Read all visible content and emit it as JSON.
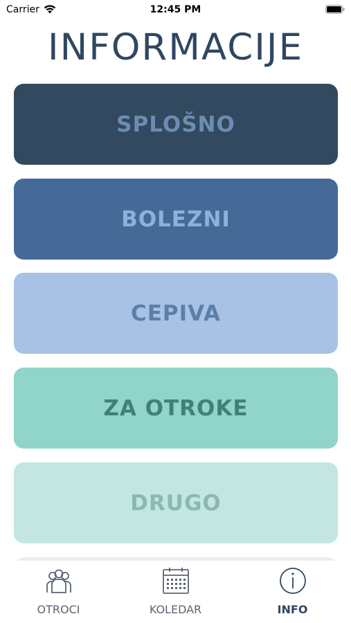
{
  "status_bar": {
    "carrier": "Carrier",
    "time": "12:45 PM",
    "icons": [
      "wifi-icon",
      "battery-icon"
    ]
  },
  "page": {
    "title": "INFORMACIJE"
  },
  "menu": {
    "items": [
      {
        "label": "SPLOŠNO",
        "color": "#33495f",
        "text_color": "#6b8db3"
      },
      {
        "label": "BOLEZNI",
        "color": "#466a98",
        "text_color": "#8fb0dc"
      },
      {
        "label": "CEPIVA",
        "color": "#a7c2e4",
        "text_color": "#5c7fa8"
      },
      {
        "label": "ZA OTROKE",
        "color": "#91d4ca",
        "text_color": "#3f8178"
      },
      {
        "label": "DRUGO",
        "color": "#c4e6e2",
        "text_color": "#8cb8b3"
      }
    ]
  },
  "tab_bar": {
    "tabs": [
      {
        "label": "OTROCI",
        "icon": "people-icon",
        "active": false
      },
      {
        "label": "KOLEDAR",
        "icon": "calendar-icon",
        "active": false
      },
      {
        "label": "INFO",
        "icon": "info-icon",
        "active": true
      }
    ],
    "accent": "#2f4760",
    "inactive_color": "#5a6470"
  }
}
